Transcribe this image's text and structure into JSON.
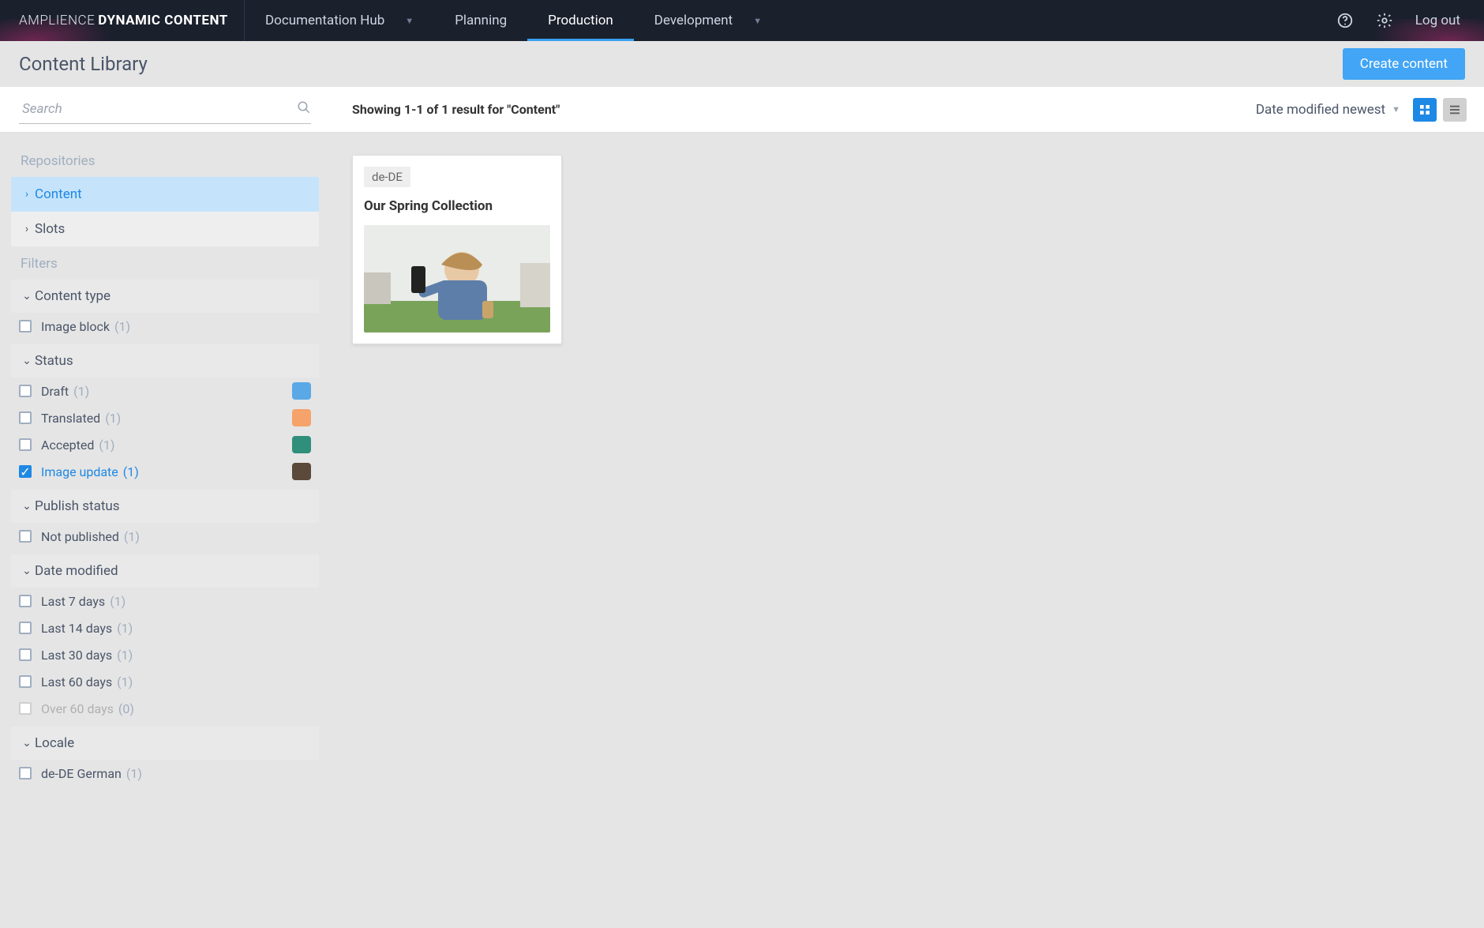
{
  "brand": {
    "thin": "AMPLIENCE",
    "bold": "DYNAMIC CONTENT"
  },
  "nav": {
    "items": [
      {
        "label": "Documentation Hub",
        "dropdown": true,
        "active": false
      },
      {
        "label": "Planning",
        "dropdown": false,
        "active": false
      },
      {
        "label": "Production",
        "dropdown": false,
        "active": true
      },
      {
        "label": "Development",
        "dropdown": true,
        "active": false
      }
    ],
    "logout": "Log out"
  },
  "page": {
    "title": "Content Library",
    "create_btn": "Create content"
  },
  "search": {
    "placeholder": "Search"
  },
  "results": {
    "summary": "Showing 1-1 of 1 result for \"Content\""
  },
  "sort": {
    "label": "Date modified newest"
  },
  "sidebar": {
    "repositories_label": "Repositories",
    "repos": [
      {
        "label": "Content",
        "active": true
      },
      {
        "label": "Slots",
        "active": false
      }
    ],
    "filters_label": "Filters",
    "groups": {
      "content_type": {
        "label": "Content type",
        "items": [
          {
            "label": "Image block",
            "count": "(1)",
            "checked": false
          }
        ]
      },
      "status": {
        "label": "Status",
        "items": [
          {
            "label": "Draft",
            "count": "(1)",
            "checked": false,
            "color": "#5aa9e6"
          },
          {
            "label": "Translated",
            "count": "(1)",
            "checked": false,
            "color": "#f5a26b"
          },
          {
            "label": "Accepted",
            "count": "(1)",
            "checked": false,
            "color": "#2f8f7a"
          },
          {
            "label": "Image update",
            "count": "(1)",
            "checked": true,
            "color": "#5b4a3a"
          }
        ]
      },
      "publish_status": {
        "label": "Publish status",
        "items": [
          {
            "label": "Not published",
            "count": "(1)",
            "checked": false
          }
        ]
      },
      "date_modified": {
        "label": "Date modified",
        "items": [
          {
            "label": "Last 7 days",
            "count": "(1)",
            "checked": false
          },
          {
            "label": "Last 14 days",
            "count": "(1)",
            "checked": false
          },
          {
            "label": "Last 30 days",
            "count": "(1)",
            "checked": false
          },
          {
            "label": "Last 60 days",
            "count": "(1)",
            "checked": false
          },
          {
            "label": "Over 60 days",
            "count": "(0)",
            "checked": false,
            "disabled": true
          }
        ]
      },
      "locale": {
        "label": "Locale",
        "items": [
          {
            "label": "de-DE German",
            "count": "(1)",
            "checked": false
          }
        ]
      }
    }
  },
  "card": {
    "locale_badge": "de-DE",
    "title": "Our Spring Collection"
  }
}
